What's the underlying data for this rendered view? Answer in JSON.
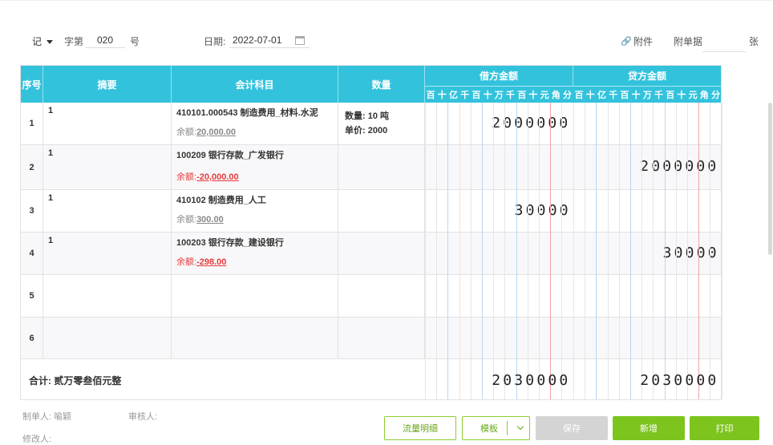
{
  "header": {
    "voucher_type": "记",
    "number_label": "字第",
    "number_value": "020",
    "number_unit": "号",
    "date_label": "日期:",
    "date_value": "2022-07-01",
    "attachment_label": "附件",
    "attached_docs_label": "附单据",
    "attached_docs_value": "",
    "attached_docs_unit": "张"
  },
  "table": {
    "columns": {
      "seq": "序号",
      "summary": "摘要",
      "account": "会计科目",
      "quantity": "数量",
      "debit": "借方金额",
      "credit": "贷方金额"
    },
    "digit_units": [
      "百",
      "十",
      "亿",
      "千",
      "百",
      "十",
      "万",
      "千",
      "百",
      "十",
      "元",
      "角",
      "分"
    ],
    "rows": [
      {
        "seq": "1",
        "summary": "1",
        "account": "410101.000543 制造费用_材料.水泥",
        "balance_label": "余额:",
        "balance": "20,000.00",
        "balance_negative": false,
        "qty_line1": "数量: 10 吨",
        "qty_line2": "单价: 2000",
        "debit": "2000000",
        "credit": ""
      },
      {
        "seq": "2",
        "summary": "1",
        "account": "100209 银行存款_广发银行",
        "balance_label": "余额:",
        "balance": "-20,000.00",
        "balance_negative": true,
        "qty_line1": "",
        "qty_line2": "",
        "debit": "",
        "credit": "2000000"
      },
      {
        "seq": "3",
        "summary": "1",
        "account": "410102 制造费用_人工",
        "balance_label": "余额:",
        "balance": "300.00",
        "balance_negative": false,
        "qty_line1": "",
        "qty_line2": "",
        "debit": "30000",
        "credit": ""
      },
      {
        "seq": "4",
        "summary": "1",
        "account": "100203 银行存款_建设银行",
        "balance_label": "余额:",
        "balance": "-298.00",
        "balance_negative": true,
        "qty_line1": "",
        "qty_line2": "",
        "debit": "",
        "credit": "30000"
      },
      {
        "seq": "5",
        "summary": "",
        "account": "",
        "balance_label": "",
        "balance": "",
        "balance_negative": false,
        "qty_line1": "",
        "qty_line2": "",
        "debit": "",
        "credit": ""
      },
      {
        "seq": "6",
        "summary": "",
        "account": "",
        "balance_label": "",
        "balance": "",
        "balance_negative": false,
        "qty_line1": "",
        "qty_line2": "",
        "debit": "",
        "credit": ""
      }
    ],
    "total": {
      "label": "合计:",
      "amount_in_words": "贰万零叁佰元整",
      "debit": "2030000",
      "credit": "2030000"
    }
  },
  "footer": {
    "maker_label": "制单人:",
    "maker_value": "喻颖",
    "auditor_label": "审核人:",
    "auditor_value": "",
    "modifier_label": "修改人:",
    "modifier_value": ""
  },
  "buttons": {
    "flow_detail": "流量明细",
    "template": "模板",
    "save": "保存",
    "add": "新增",
    "print": "打印"
  },
  "colors": {
    "header_bg": "#33c2dc",
    "accent_green": "#7dc41f",
    "negative_red": "#e63a3a"
  }
}
